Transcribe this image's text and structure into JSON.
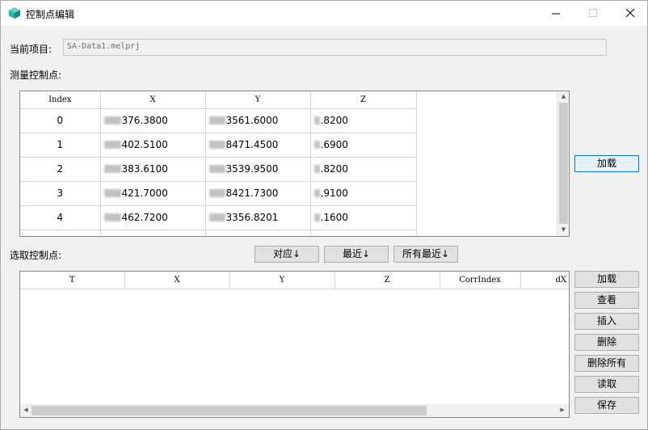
{
  "window": {
    "title": "控制点编辑",
    "min_symbol": "—",
    "max_symbol": "☐",
    "close_symbol": "✕"
  },
  "project": {
    "label": "当前项目:",
    "value": "SA-Data1.melprj"
  },
  "measured": {
    "label": "测量控制点:",
    "headers": [
      "Index",
      "X",
      "Y",
      "Z"
    ],
    "rows": [
      {
        "index": "0",
        "x": "376.3800",
        "y": "3561.6000",
        "z": ".8200"
      },
      {
        "index": "1",
        "x": "402.5100",
        "y": "8471.4500",
        "z": ".6900"
      },
      {
        "index": "2",
        "x": "383.6100",
        "y": "3539.9500",
        "z": ".8200"
      },
      {
        "index": "3",
        "x": "421.7000",
        "y": "8421.7300",
        "z": ".9100"
      },
      {
        "index": "4",
        "x": "462.7200",
        "y": "3356.8201",
        "z": ".1600"
      }
    ],
    "load_button": "加载"
  },
  "selected": {
    "label": "选取控制点:",
    "match_buttons": [
      "对应↓",
      "最近↓",
      "所有最近↓"
    ],
    "headers": [
      "T",
      "X",
      "Y",
      "Z",
      "CorrIndex",
      "dX"
    ],
    "rows": [],
    "side_buttons": [
      "加载",
      "查看",
      "插入",
      "删除",
      "删除所有",
      "读取",
      "保存"
    ]
  },
  "colors": {
    "focus_border": "#0078d7",
    "icon_teal": "#1fb5a8"
  }
}
